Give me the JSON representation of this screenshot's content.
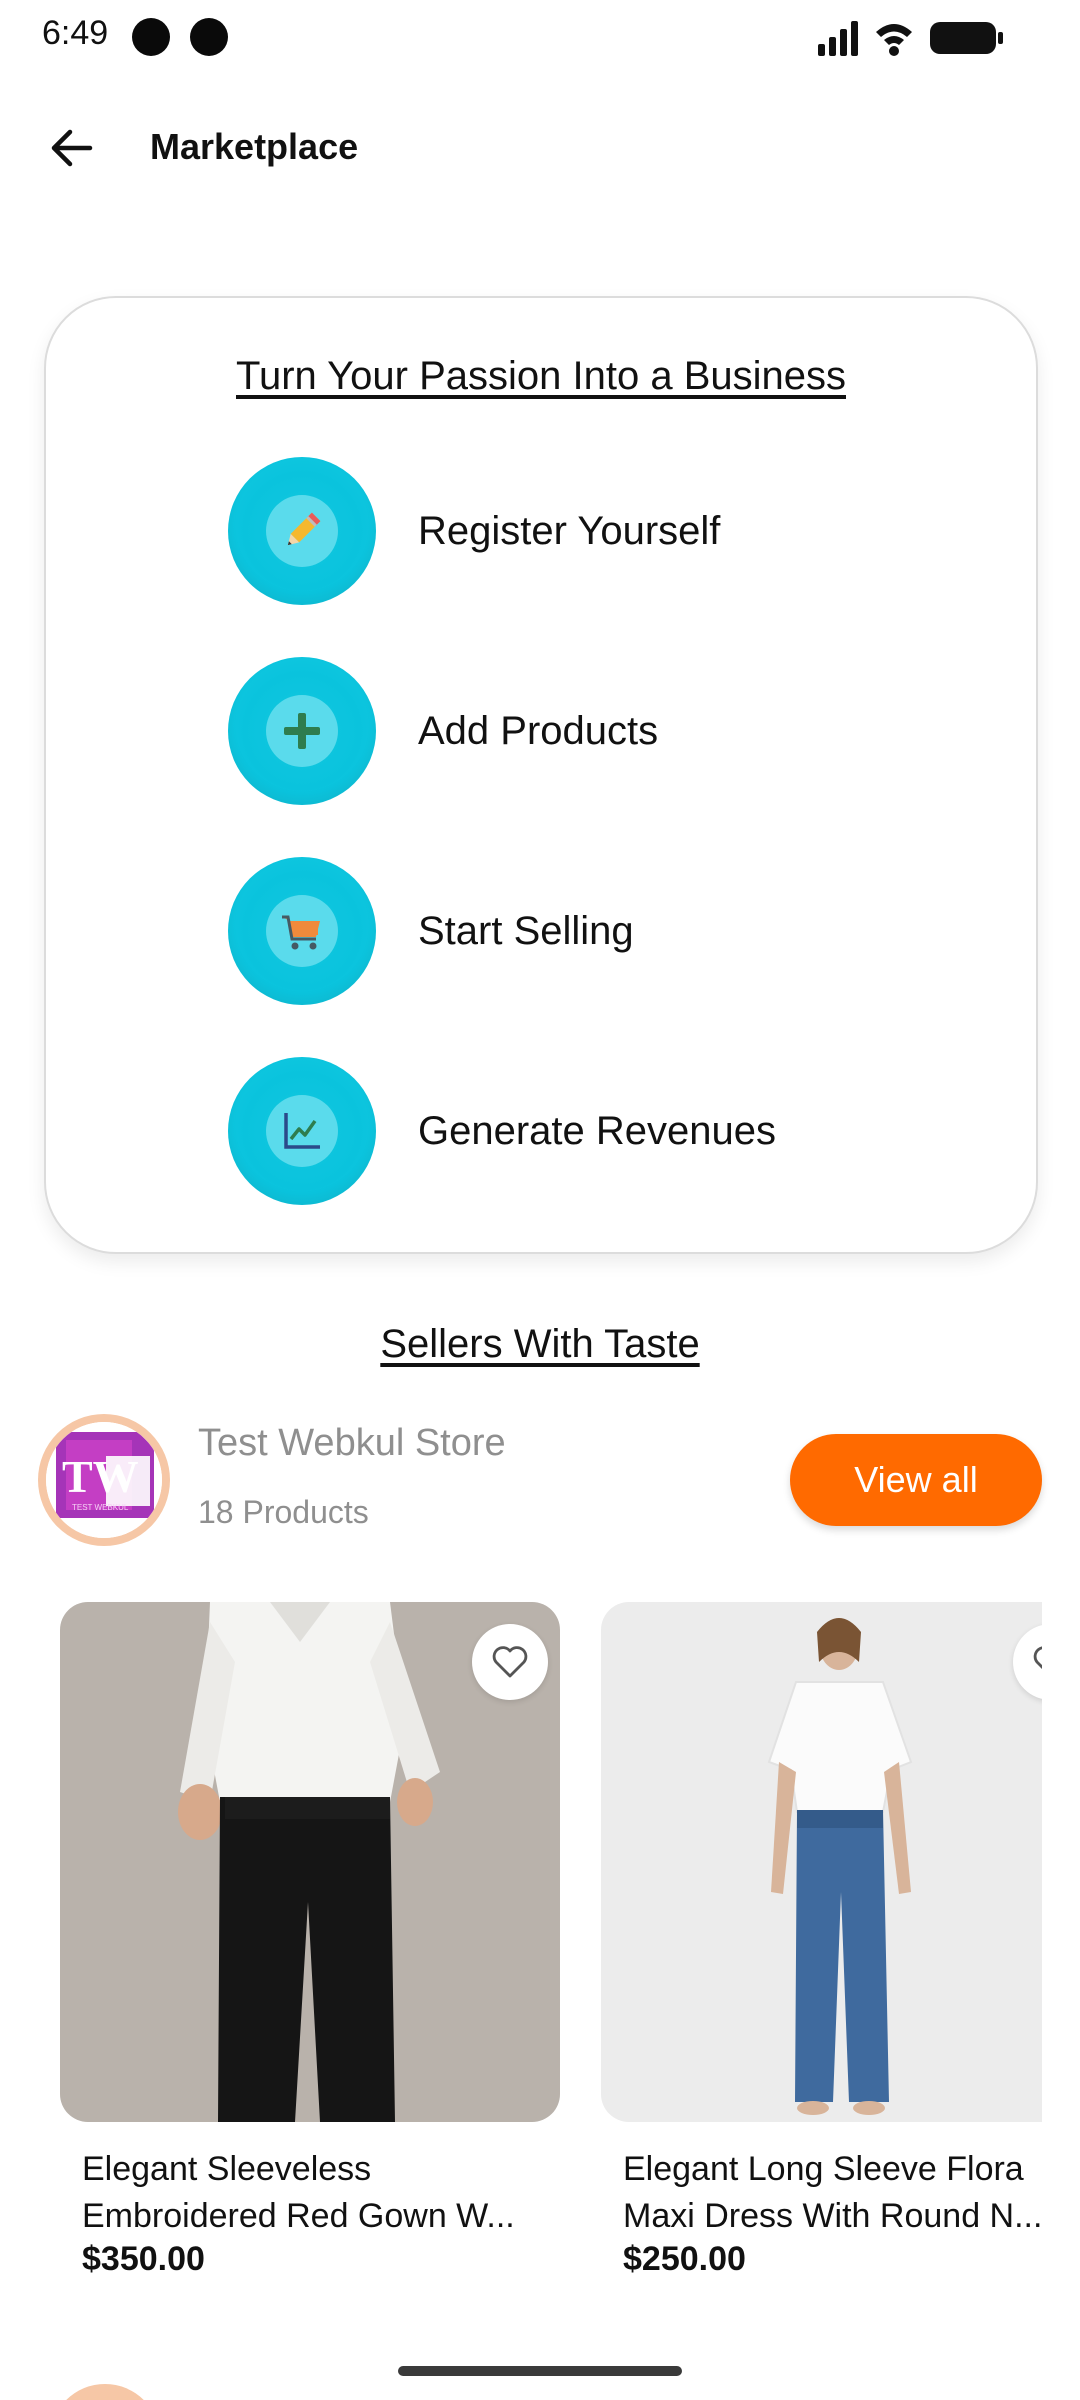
{
  "status_bar": {
    "time": "6:49"
  },
  "app_bar": {
    "title": "Marketplace",
    "back_icon": "arrow-left-icon"
  },
  "steps": {
    "heading": "Turn Your Passion Into a Business",
    "items": [
      {
        "label": "Register Yourself",
        "icon": "pencil-icon"
      },
      {
        "label": "Add Products",
        "icon": "plus-icon"
      },
      {
        "label": "Start Selling",
        "icon": "cart-icon"
      },
      {
        "label": "Generate Revenues",
        "icon": "chart-icon"
      }
    ]
  },
  "sellers": {
    "heading": "Sellers With Taste",
    "store": {
      "logo_text": "TW",
      "logo_subtext": "TEST WEBKUL",
      "name": "Test Webkul Store",
      "count": "18 Products",
      "view_all": "View all"
    },
    "products": [
      {
        "name_line1": "Elegant Sleeveless",
        "name_line2": "Embroidered Red Gown W...",
        "price": "$350.00"
      },
      {
        "name_line1": "Elegant Long Sleeve Flora",
        "name_line2": "Maxi Dress With Round N...",
        "price": "$250.00"
      }
    ]
  },
  "colors": {
    "accent_orange": "#ff6a00",
    "step_cyan": "#0ac3dd",
    "muted_text": "#8f8f8f"
  }
}
